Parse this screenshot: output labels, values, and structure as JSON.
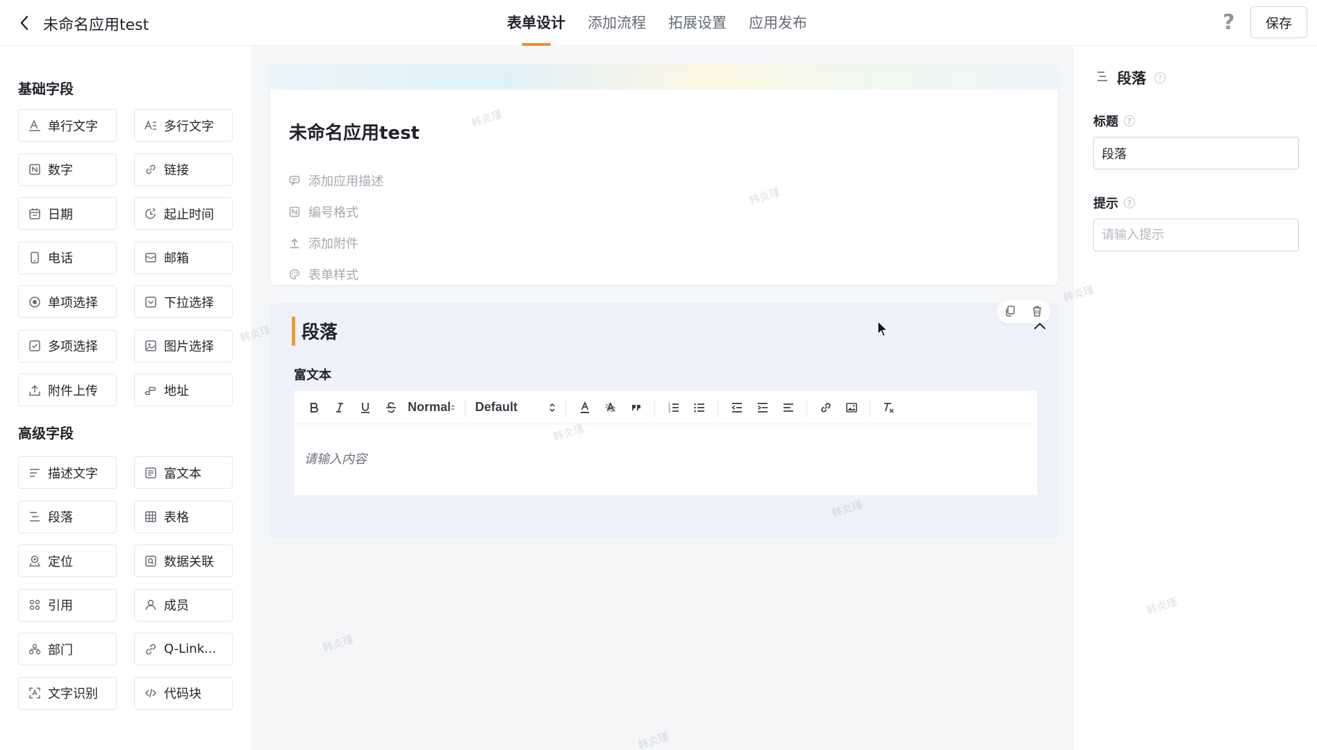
{
  "header": {
    "app_title": "未命名应用test",
    "tabs": [
      {
        "label": "表单设计",
        "active": true
      },
      {
        "label": "添加流程",
        "active": false
      },
      {
        "label": "拓展设置",
        "active": false
      },
      {
        "label": "应用发布",
        "active": false
      }
    ],
    "save_label": "保存",
    "help_glyph": "?"
  },
  "palette": {
    "basic_title": "基础字段",
    "basic_fields": [
      {
        "label": "单行文字",
        "icon": "single-line-text-icon"
      },
      {
        "label": "多行文字",
        "icon": "multi-line-text-icon"
      },
      {
        "label": "数字",
        "icon": "number-icon"
      },
      {
        "label": "链接",
        "icon": "link-icon"
      },
      {
        "label": "日期",
        "icon": "calendar-icon"
      },
      {
        "label": "起止时间",
        "icon": "time-range-icon"
      },
      {
        "label": "电话",
        "icon": "phone-icon"
      },
      {
        "label": "邮箱",
        "icon": "mail-icon"
      },
      {
        "label": "单项选择",
        "icon": "radio-icon"
      },
      {
        "label": "下拉选择",
        "icon": "dropdown-icon"
      },
      {
        "label": "多项选择",
        "icon": "checkbox-icon"
      },
      {
        "label": "图片选择",
        "icon": "image-icon"
      },
      {
        "label": "附件上传",
        "icon": "upload-icon"
      },
      {
        "label": "地址",
        "icon": "address-icon"
      }
    ],
    "advanced_title": "高级字段",
    "advanced_fields": [
      {
        "label": "描述文字",
        "icon": "description-icon"
      },
      {
        "label": "富文本",
        "icon": "rich-text-icon"
      },
      {
        "label": "段落",
        "icon": "paragraph-icon"
      },
      {
        "label": "表格",
        "icon": "table-icon"
      },
      {
        "label": "定位",
        "icon": "location-icon"
      },
      {
        "label": "数据关联",
        "icon": "data-link-icon"
      },
      {
        "label": "引用",
        "icon": "reference-icon"
      },
      {
        "label": "成员",
        "icon": "member-icon"
      },
      {
        "label": "部门",
        "icon": "department-icon"
      },
      {
        "label": "Q-Link...",
        "icon": "q-link-icon"
      },
      {
        "label": "文字识别",
        "icon": "ocr-icon"
      },
      {
        "label": "代码块",
        "icon": "code-icon"
      }
    ]
  },
  "form": {
    "title": "未命名应用test",
    "meta": [
      {
        "label": "添加应用描述",
        "icon": "comment-icon"
      },
      {
        "label": "编号格式",
        "icon": "number-format-icon"
      },
      {
        "label": "添加附件",
        "icon": "attachment-upload-icon"
      },
      {
        "label": "表单样式",
        "icon": "palette-icon"
      }
    ],
    "paragraph": {
      "title": "段落",
      "rich_text_label": "富文本",
      "toolbar": {
        "header_select": "Normal",
        "font_select": "Default"
      },
      "editor_placeholder": "请输入内容"
    }
  },
  "right_panel": {
    "type_name": "段落",
    "title_label": "标题",
    "title_value": "段落",
    "hint_label": "提示",
    "hint_placeholder": "请输入提示"
  },
  "watermark": "韩炎瑾",
  "colors": {
    "accent": "#f5883c",
    "paragraph_bar": "#f09a31",
    "canvas_bg": "#f5f6f8",
    "paragraph_bg": "#eff1fb"
  }
}
